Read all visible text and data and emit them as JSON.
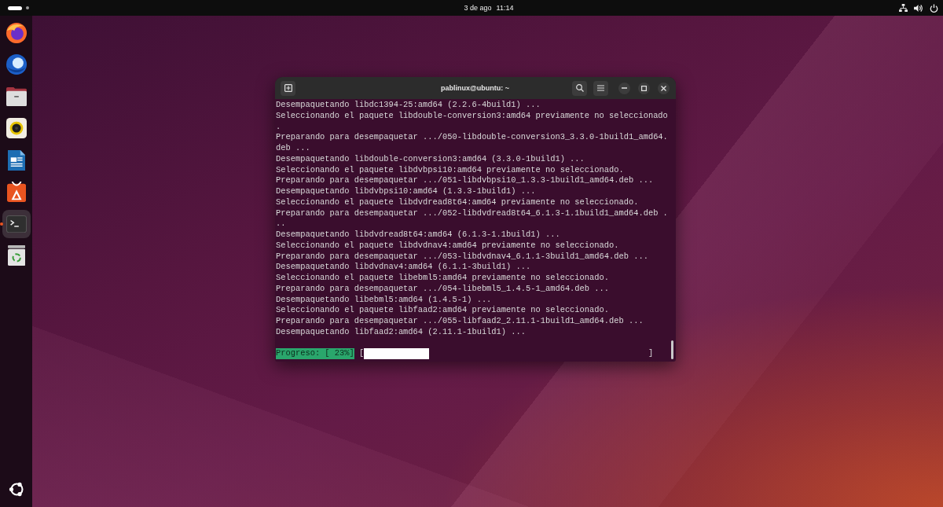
{
  "top_bar": {
    "workspaces": [
      {
        "selected": true
      },
      {
        "selected": false
      }
    ],
    "date": "3 de ago",
    "time": "11:14"
  },
  "dock": {
    "items": [
      {
        "kind": "browser",
        "selected": false,
        "running": false
      },
      {
        "kind": "mail",
        "selected": false,
        "running": false
      },
      {
        "kind": "files",
        "selected": false,
        "running": false
      },
      {
        "kind": "music",
        "selected": false,
        "running": false
      },
      {
        "kind": "writer",
        "selected": false,
        "running": false
      },
      {
        "kind": "store",
        "selected": false,
        "running": false
      },
      {
        "kind": "terminal",
        "selected": true,
        "running": true
      },
      {
        "kind": "trash",
        "selected": false,
        "running": false
      }
    ]
  },
  "terminal": {
    "title": "pablinux@ubuntu: ~",
    "lines": [
      "Desempaquetando libdc1394-25:amd64 (2.2.6-4build1) ...",
      "Seleccionando el paquete libdouble-conversion3:amd64 previamente no seleccionado",
      ".",
      "Preparando para desempaquetar .../050-libdouble-conversion3_3.3.0-1build1_amd64.",
      "deb ...",
      "Desempaquetando libdouble-conversion3:amd64 (3.3.0-1build1) ...",
      "Seleccionando el paquete libdvbpsi10:amd64 previamente no seleccionado.",
      "Preparando para desempaquetar .../051-libdvbpsi10_1.3.3-1build1_amd64.deb ...",
      "Desempaquetando libdvbpsi10:amd64 (1.3.3-1build1) ...",
      "Seleccionando el paquete libdvdread8t64:amd64 previamente no seleccionado.",
      "Preparando para desempaquetar .../052-libdvdread8t64_6.1.3-1.1build1_amd64.deb .",
      "..",
      "Desempaquetando libdvdread8t64:amd64 (6.1.3-1.1build1) ...",
      "Seleccionando el paquete libdvdnav4:amd64 previamente no seleccionado.",
      "Preparando para desempaquetar .../053-libdvdnav4_6.1.1-3build1_amd64.deb ...",
      "Desempaquetando libdvdnav4:amd64 (6.1.1-3build1) ...",
      "Seleccionando el paquete libebml5:amd64 previamente no seleccionado.",
      "Preparando para desempaquetar .../054-libebml5_1.4.5-1_amd64.deb ...",
      "Desempaquetando libebml5:amd64 (1.4.5-1) ...",
      "Seleccionando el paquete libfaad2:amd64 previamente no seleccionado.",
      "Preparando para desempaquetar .../055-libfaad2_2.11.1-1build1_amd64.deb ...",
      "Desempaquetando libfaad2:amd64 (2.11.1-1build1) ..."
    ],
    "progress": {
      "label": "Progreso: [ 23%]",
      "open_bracket": "[",
      "close_bracket": "]",
      "level": 0.23
    }
  }
}
